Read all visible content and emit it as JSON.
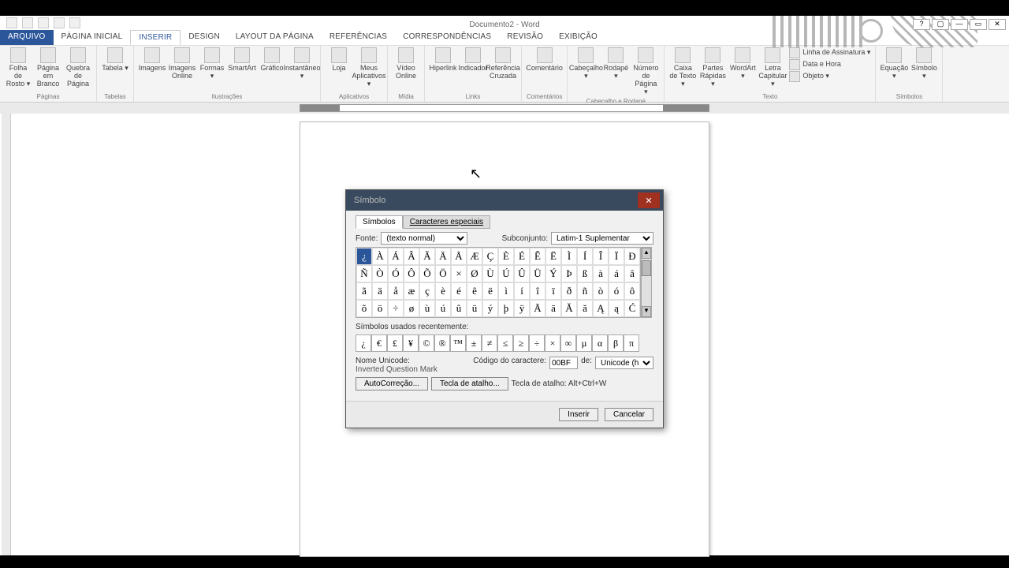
{
  "app": {
    "title": "Documento2 - Word"
  },
  "tabs": {
    "file": "ARQUIVO",
    "items": [
      "PÁGINA INICIAL",
      "INSERIR",
      "DESIGN",
      "LAYOUT DA PÁGINA",
      "REFERÊNCIAS",
      "CORRESPONDÊNCIAS",
      "REVISÃO",
      "EXIBIÇÃO"
    ],
    "active_index": 1
  },
  "ribbon": {
    "groups": [
      {
        "label": "Páginas",
        "items": [
          "Folha de Rosto ▾",
          "Página em Branco",
          "Quebra de Página"
        ]
      },
      {
        "label": "Tabelas",
        "items": [
          "Tabela ▾"
        ]
      },
      {
        "label": "Ilustrações",
        "items": [
          "Imagens",
          "Imagens Online",
          "Formas ▾",
          "SmartArt",
          "Gráfico",
          "Instantâneo ▾"
        ]
      },
      {
        "label": "Aplicativos",
        "items": [
          "Loja",
          "Meus Aplicativos ▾"
        ]
      },
      {
        "label": "Mídia",
        "items": [
          "Vídeo Online"
        ]
      },
      {
        "label": "Links",
        "items": [
          "Hiperlink",
          "Indicador",
          "Referência Cruzada"
        ]
      },
      {
        "label": "Comentários",
        "items": [
          "Comentário"
        ]
      },
      {
        "label": "Cabeçalho e Rodapé",
        "items": [
          "Cabeçalho ▾",
          "Rodapé ▾",
          "Número de Página ▾"
        ]
      },
      {
        "label": "Texto",
        "items": [
          "Caixa de Texto ▾",
          "Partes Rápidas ▾",
          "WordArt ▾",
          "Letra Capitular ▾"
        ],
        "extra": [
          "Linha de Assinatura ▾",
          "Data e Hora",
          "Objeto ▾"
        ]
      },
      {
        "label": "Símbolos",
        "items": [
          "Equação ▾",
          "Símbolo ▾"
        ]
      }
    ]
  },
  "dialog": {
    "title": "Símbolo",
    "tabs": {
      "symbols": "Símbolos",
      "special": "Caracteres especiais"
    },
    "font_label": "Fonte:",
    "font_value": "(texto normal)",
    "subset_label": "Subconjunto:",
    "subset_value": "Latim-1 Suplementar",
    "grid": [
      [
        "¿",
        "À",
        "Á",
        "Â",
        "Ã",
        "Ä",
        "Å",
        "Æ",
        "Ç",
        "È",
        "É",
        "Ê",
        "Ë",
        "Ì",
        "Í",
        "Î",
        "Ï",
        "Ð"
      ],
      [
        "Ñ",
        "Ò",
        "Ó",
        "Ô",
        "Õ",
        "Ö",
        "×",
        "Ø",
        "Ù",
        "Ú",
        "Û",
        "Ü",
        "Ý",
        "Þ",
        "ß",
        "à",
        "á",
        "â"
      ],
      [
        "ã",
        "ä",
        "å",
        "æ",
        "ç",
        "è",
        "é",
        "ê",
        "ë",
        "ì",
        "í",
        "î",
        "ï",
        "ð",
        "ñ",
        "ò",
        "ó",
        "ô"
      ],
      [
        "õ",
        "ö",
        "÷",
        "ø",
        "ù",
        "ú",
        "û",
        "ü",
        "ý",
        "þ",
        "ÿ",
        "Ā",
        "ā",
        "Ă",
        "ă",
        "Ą",
        "ą",
        "Ć"
      ]
    ],
    "selected": "¿",
    "recent_label": "Símbolos usados recentemente:",
    "recent": [
      "¿",
      "€",
      "£",
      "¥",
      "©",
      "®",
      "™",
      "±",
      "≠",
      "≤",
      "≥",
      "÷",
      "×",
      "∞",
      "µ",
      "α",
      "β",
      "π"
    ],
    "unicode_name_label": "Nome Unicode:",
    "unicode_name": "Inverted Question Mark",
    "code_label": "Código do caractere:",
    "code_value": "00BF",
    "from_label": "de:",
    "from_value": "Unicode (hex)",
    "autocorrect": "AutoCorreção...",
    "shortcut_btn": "Tecla de atalho...",
    "shortcut_label": "Tecla de atalho: Alt+Ctrl+W",
    "insert": "Inserir",
    "cancel": "Cancelar"
  }
}
